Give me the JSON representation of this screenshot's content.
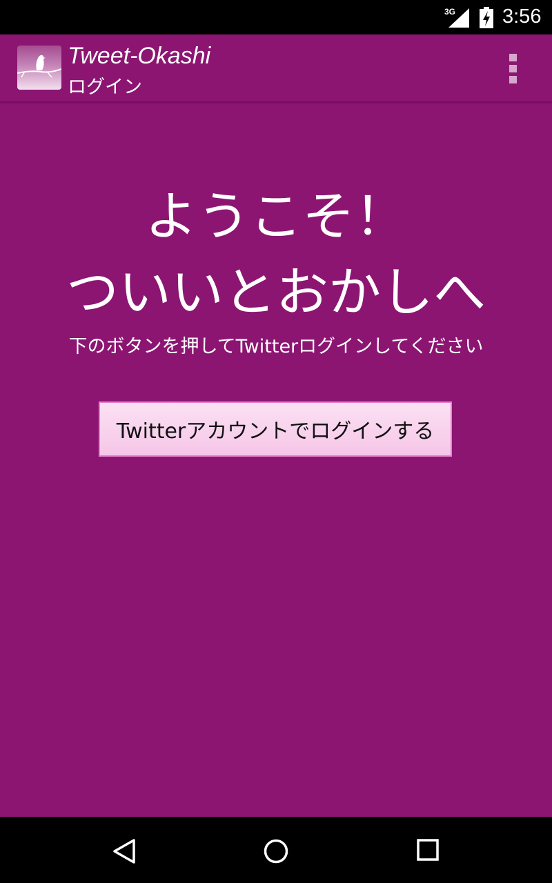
{
  "status_bar": {
    "network": "3G",
    "time": "3:56",
    "icons": [
      "signal-icon",
      "battery-charging-icon"
    ]
  },
  "action_bar": {
    "title": "Tweet-Okashi",
    "subtitle": "ログイン",
    "icons": [
      "app-icon",
      "overflow-menu-icon"
    ]
  },
  "main": {
    "welcome_line1": "ようこそ！",
    "welcome_line2": "ついいとおかしへ",
    "instruction": "下のボタンを押してTwitterログインしてください",
    "login_button_label": "Twitterアカウントでログインする"
  },
  "nav_bar": {
    "icons": [
      "back-icon",
      "home-icon",
      "recents-icon"
    ]
  },
  "colors": {
    "primary": "#8c1572",
    "button_bg": "#f9d2ee",
    "button_border": "#e77fd0",
    "system_bar": "#000000"
  }
}
